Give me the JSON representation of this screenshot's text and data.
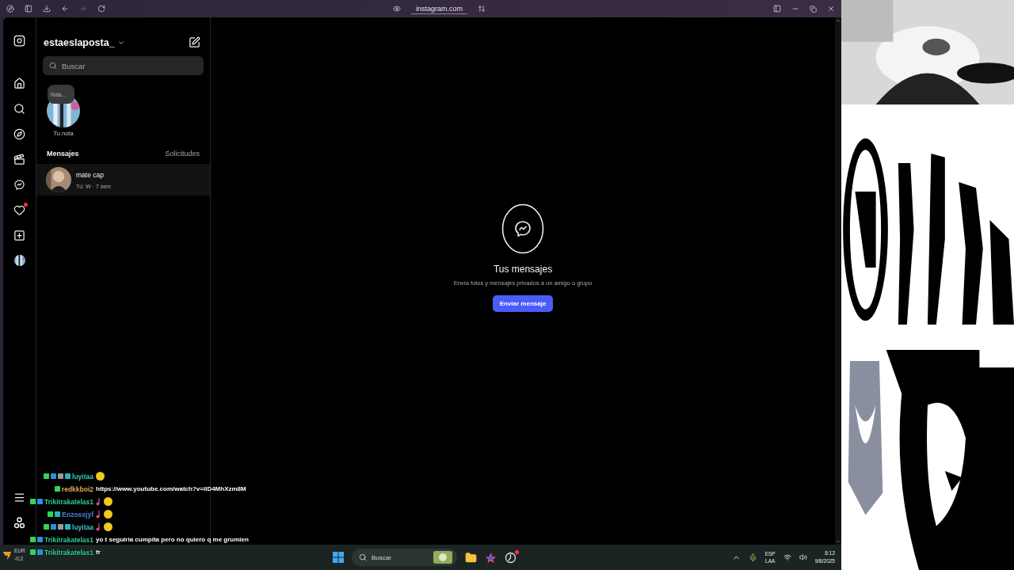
{
  "browser": {
    "url": "instagram.com"
  },
  "nav": {
    "notifications_dot": true
  },
  "account": {
    "username": "estaeslaposta_"
  },
  "search": {
    "placeholder": "Buscar"
  },
  "note": {
    "bubble": "Nota...",
    "caption": "Tu nota"
  },
  "messages_header": {
    "title": "Mensajes",
    "requests": "Solicitudes"
  },
  "conversations": [
    {
      "name": "mate cap",
      "preview": "Tú: W · 7 sem",
      "selected": true
    }
  ],
  "empty_state": {
    "title": "Tus mensajes",
    "subtitle": "Envía fotos y mensajes privados a un amigo o grupo",
    "button": "Enviar mensaje"
  },
  "widget": {
    "label": "EUR",
    "value": "-0,2"
  },
  "chat": [
    {
      "user": "luyitaa",
      "color": "#3fc7c9",
      "badges": [
        {
          "color": "#35d35a"
        },
        {
          "color": "#2b8fe0"
        },
        {
          "color": "#9a9a9a"
        },
        {
          "color": "#20b8c0"
        }
      ],
      "kind": "emote"
    },
    {
      "user": "redkkboi2",
      "color": "#e0a45a",
      "badges": [
        {
          "color": "#35d35a"
        }
      ],
      "kind": "text",
      "text": "https://www.youtube.com/watch?v=iID4MhXzm8M"
    },
    {
      "user": "Trikitrakatelas1",
      "color": "#2fcf9a",
      "badges": [
        {
          "color": "#35d35a"
        },
        {
          "color": "#2b8fe0"
        }
      ],
      "kind": "note_emote"
    },
    {
      "user": "Enzossjyf",
      "color": "#4a7fd6",
      "badges": [
        {
          "color": "#35d35a"
        },
        {
          "color": "#20b8c0"
        }
      ],
      "kind": "note_emote"
    },
    {
      "user": "luyitaa",
      "color": "#3fc7c9",
      "badges": [
        {
          "color": "#35d35a"
        },
        {
          "color": "#2b8fe0"
        },
        {
          "color": "#9a9a9a"
        },
        {
          "color": "#20b8c0"
        }
      ],
      "kind": "note_emote"
    },
    {
      "user": "Trikitrakatelas1",
      "color": "#2fcf9a",
      "badges": [
        {
          "color": "#35d35a"
        },
        {
          "color": "#2b8fe0"
        }
      ],
      "kind": "text",
      "text": "yo t seguiria cumpita pero no quiero q me grumien"
    },
    {
      "user": "Trikitrakatelas1",
      "color": "#2fcf9a",
      "badges": [
        {
          "color": "#35d35a"
        },
        {
          "color": "#2b8fe0"
        }
      ],
      "kind": "text",
      "text": "fr"
    }
  ],
  "taskbar": {
    "search": "Buscar",
    "language": "ESP",
    "layout": "LAA",
    "time": "8:12",
    "date": "9/8/2025"
  }
}
